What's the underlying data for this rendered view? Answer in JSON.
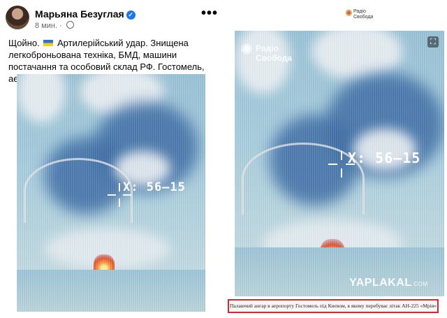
{
  "left_post": {
    "author": "Марьяна Безуглая",
    "time": "8 мин.",
    "more_label": "•••",
    "text_before_flag": "Щойно.",
    "text_after_flag": "Артилерійський удар. Знищена легкоброньована техніка, БМД, машини постачання та особовий склад РФ. Гостомель, аеродром.",
    "photo_overlay": "X: 56–15"
  },
  "right_post": {
    "logo_line1": "Радіо",
    "logo_line2": "Свобода",
    "watermark_line1": "Радіо",
    "watermark_line2": "Свобода",
    "photo_overlay": "X: 56–15",
    "site_watermark": "YAPLAKAL",
    "site_watermark_suffix": ".COM",
    "caption": "Палаючий ангар в аеропорту Гостомель під Києвом, в якому перебуває літак АН-225 «Мрія»"
  },
  "colors": {
    "verified_badge": "#1877f2",
    "caption_border": "#d9262f",
    "brand_orange": "#d2691e"
  }
}
